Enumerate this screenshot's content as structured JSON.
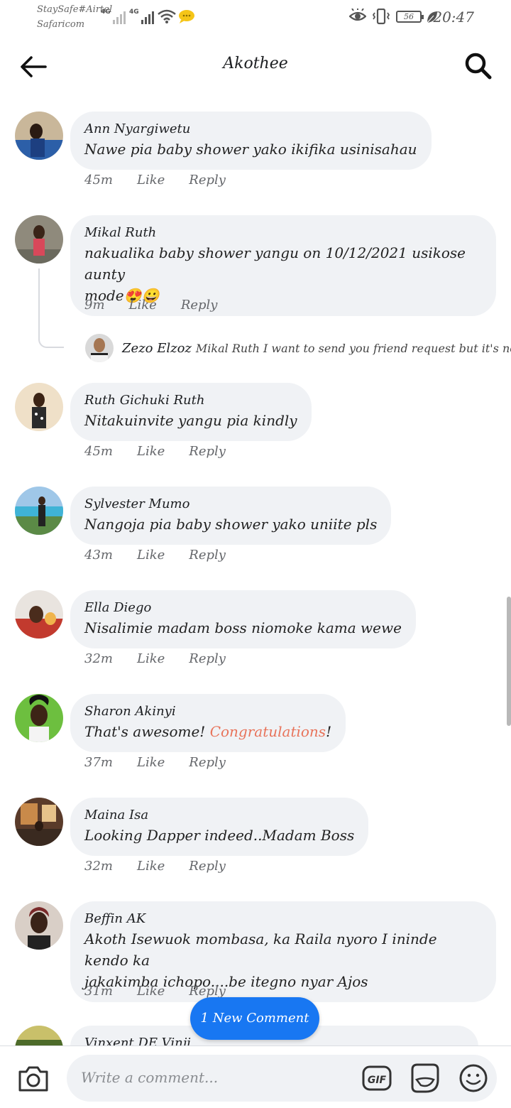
{
  "status_bar": {
    "carrier_1": "StaySafe#Airtel",
    "carrier_2": "Safaricom",
    "network_1": "4G",
    "network_2": "4G",
    "battery_level": "56",
    "time": "20:47"
  },
  "header": {
    "title": "Akothee"
  },
  "comments": [
    {
      "author": "Ann Nyargiwetu",
      "text": "Nawe pia baby shower yako ikifika usinisahau",
      "time": "45m",
      "like_label": "Like",
      "reply_label": "Reply"
    },
    {
      "author": "Mikal Ruth",
      "text_line_1": "nakualika baby shower yangu on 10/12/2021 usikose aunty",
      "text_line_2": "mode",
      "emojis": "😍😀",
      "time": "9m",
      "like_label": "Like",
      "reply_label": "Reply"
    },
    {
      "author": "Ruth Gichuki Ruth",
      "text": "Nitakuinvite yangu pia kindly",
      "time": "45m",
      "like_label": "Like",
      "reply_label": "Reply"
    },
    {
      "author": "Sylvester Mumo",
      "text": "Nangoja pia baby shower yako uniite pls",
      "time": "43m",
      "like_label": "Like",
      "reply_label": "Reply"
    },
    {
      "author": "Ella Diego",
      "text": "Nisalimie madam boss niomoke kama wewe",
      "time": "32m",
      "like_label": "Like",
      "reply_label": "Reply"
    },
    {
      "author": "Sharon Akinyi",
      "text_before": "That's awesome! ",
      "text_highlight": "Congratulations",
      "text_after": "!",
      "highlight_color": "#e8735a",
      "time": "37m",
      "like_label": "Like",
      "reply_label": "Reply"
    },
    {
      "author": "Maina Isa",
      "text": "Looking Dapper indeed..Madam Boss",
      "time": "32m",
      "like_label": "Like",
      "reply_label": "Reply"
    },
    {
      "author": "Beffin AK",
      "text_line_1": "Akoth Isewuok mombasa,  ka Raila nyoro I ininde kendo ka",
      "text_line_2": "jakakimba ichopo....be itegno nyar Ajos",
      "time": "31m",
      "like_label": "Like",
      "reply_label": "Reply"
    },
    {
      "author": "Vinxent DE Vinji"
    }
  ],
  "reply_preview": {
    "author": "Zezo Elzoz",
    "text": "Mikal Ruth I want to send you friend request but it's not..."
  },
  "new_comment_pill": "1 New Comment",
  "composer": {
    "placeholder": "Write a comment...",
    "gif_label": "GIF"
  },
  "colors": {
    "accent_blue": "#1877f2",
    "bubble_bg": "#f0f2f5"
  },
  "icons": [
    "back-arrow-icon",
    "search-icon",
    "camera-icon",
    "gif-icon",
    "sticker-icon",
    "emoji-icon"
  ]
}
